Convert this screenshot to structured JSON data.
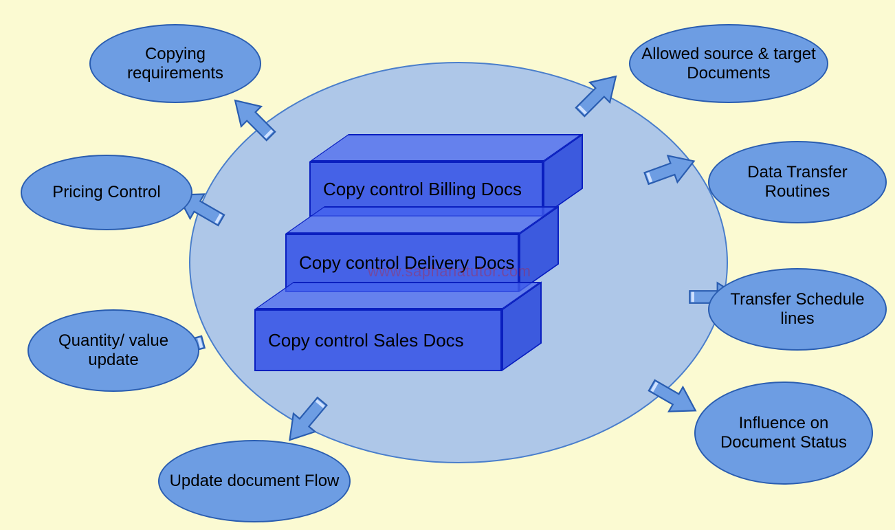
{
  "diagram": {
    "big_circle": true,
    "watermark": "www.saphanatutor.com",
    "center_blocks": {
      "back": {
        "label": "Copy control Billing Docs"
      },
      "middle": {
        "label": "Copy control Delivery Docs"
      },
      "front": {
        "label": "Copy control Sales Docs"
      }
    },
    "bubbles": {
      "copying_requirements": {
        "label": "Copying requirements"
      },
      "allowed_source_target_docs": {
        "label": "Allowed source & target Documents"
      },
      "pricing_control": {
        "label": "Pricing Control"
      },
      "data_transfer_routines": {
        "label": "Data Transfer Routines"
      },
      "transfer_schedule_lines": {
        "label": "Transfer Schedule lines"
      },
      "quantity_value_update": {
        "label": "Quantity/ value update"
      },
      "influence_document_status": {
        "label": "Influence on Document Status"
      },
      "update_document_flow": {
        "label": "Update document Flow"
      }
    }
  }
}
